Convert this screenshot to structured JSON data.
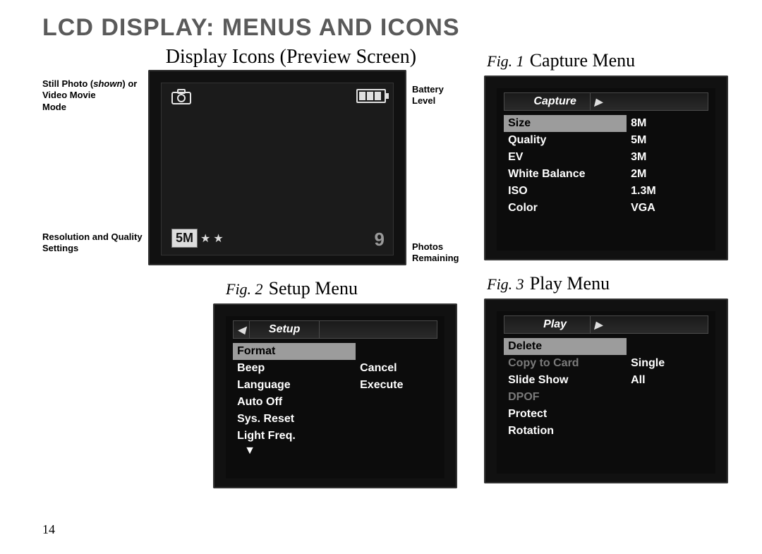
{
  "page_title": "LCD DISPLAY: MENUS AND ICONS",
  "page_number": "14",
  "preview": {
    "heading": "Display Icons (Preview Screen)",
    "label_mode_line1": "Still Photo (",
    "label_mode_shown": "shown",
    "label_mode_line1b": ") or",
    "label_mode_line2": "Video Movie",
    "label_mode_line3": "Mode",
    "label_res_line1": "Resolution and Quality",
    "label_res_line2": "Settings",
    "label_batt_line1": "Battery",
    "label_batt_line2": "Level",
    "label_photos_line1": "Photos",
    "label_photos_line2": "Remaining",
    "res_badge": "5M",
    "photos_remaining": "9"
  },
  "captureMenu": {
    "fig_prefix": "Fig. 1",
    "title": "Capture Menu",
    "tab": "Capture",
    "left": [
      "Size",
      "Quality",
      "EV",
      "White Balance",
      "ISO",
      "Color"
    ],
    "right": [
      "8M",
      "5M",
      "3M",
      "2M",
      "1.3M",
      "VGA"
    ]
  },
  "setupMenu": {
    "fig_prefix": "Fig. 2",
    "title": "Setup Menu",
    "tab": "Setup",
    "left": [
      "Format",
      "Beep",
      "Language",
      "Auto Off",
      "Sys. Reset",
      "Light Freq."
    ],
    "right": [
      "",
      "Cancel",
      "Execute",
      "",
      "",
      ""
    ],
    "more": "▼"
  },
  "playMenu": {
    "fig_prefix": "Fig. 3",
    "title": "Play Menu",
    "tab": "Play",
    "left": [
      "Delete",
      "Copy to Card",
      "Slide Show",
      "DPOF",
      "Protect",
      "Rotation"
    ],
    "right": [
      "",
      "Single",
      "All",
      "",
      "",
      ""
    ]
  }
}
